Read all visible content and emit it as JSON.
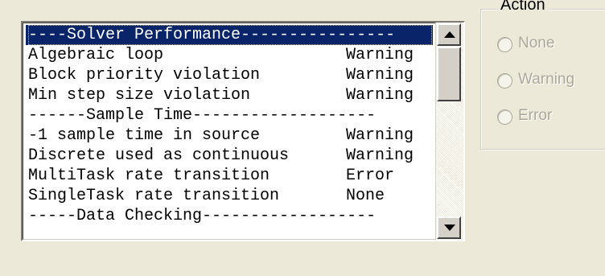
{
  "diagnostics_list": {
    "rows": [
      {
        "name": "----Solver Performance----------------",
        "value": "",
        "header": true,
        "selected": true
      },
      {
        "name": "Algebraic loop",
        "value": "Warning"
      },
      {
        "name": "Block priority violation",
        "value": "Warning"
      },
      {
        "name": "Min step size violation",
        "value": "Warning"
      },
      {
        "name": "------Sample Time-------------------",
        "value": "",
        "header": true
      },
      {
        "name": "-1 sample time in source",
        "value": "Warning"
      },
      {
        "name": "Discrete used as continuous",
        "value": "Warning"
      },
      {
        "name": "MultiTask rate transition",
        "value": "Error"
      },
      {
        "name": "SingleTask rate transition",
        "value": "None"
      },
      {
        "name": "-----Data Checking------------------",
        "value": "",
        "header": true
      }
    ],
    "scroll_up_icon": "arrow-up-icon",
    "scroll_down_icon": "arrow-down-icon"
  },
  "action_group": {
    "title": "Action",
    "options": [
      {
        "label": "None",
        "enabled": false,
        "checked": false
      },
      {
        "label": "Warning",
        "enabled": false,
        "checked": false
      },
      {
        "label": "Error",
        "enabled": false,
        "checked": false
      }
    ]
  },
  "colors": {
    "window_bg": "#ece9d8",
    "selection_bg": "#0a246a",
    "disabled_text": "#aca899"
  }
}
